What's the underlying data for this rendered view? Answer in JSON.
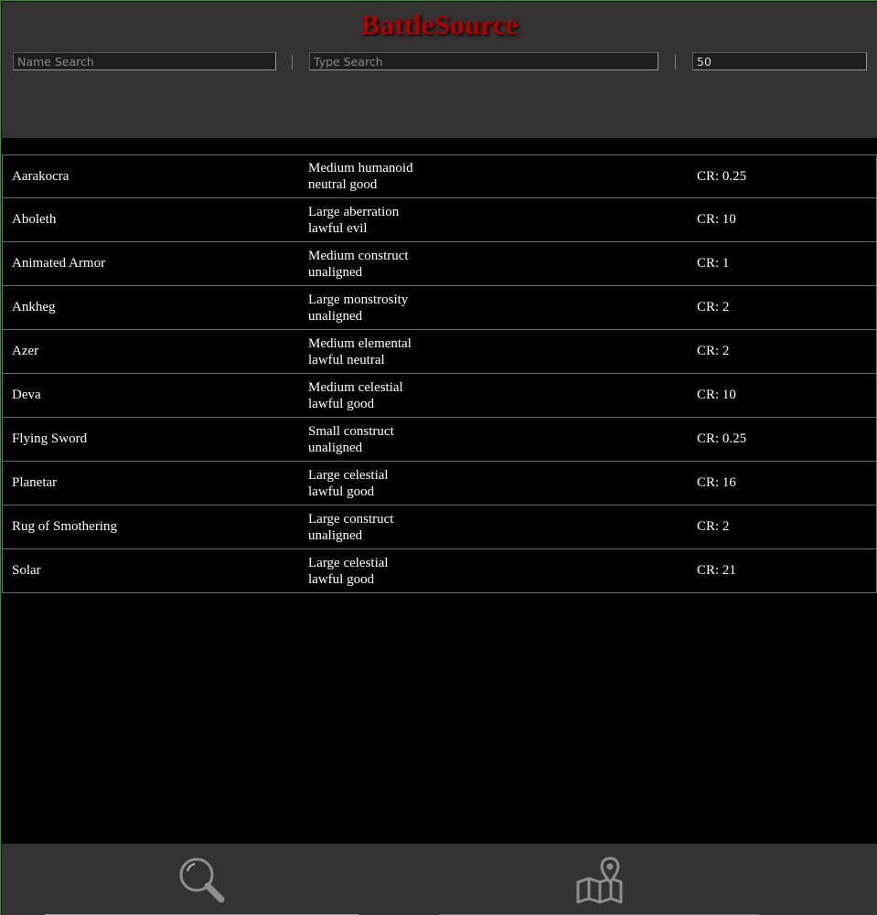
{
  "app": {
    "title": "BattleSource"
  },
  "filters": {
    "name_placeholder": "Name Search",
    "type_placeholder": "Type Search",
    "limit_value": "50"
  },
  "monsters": [
    {
      "name": "Aarakocra",
      "size_type": "Medium humanoid",
      "alignment": "neutral good",
      "cr": "CR: 0.25"
    },
    {
      "name": "Aboleth",
      "size_type": "Large aberration",
      "alignment": "lawful evil",
      "cr": "CR: 10"
    },
    {
      "name": "Animated Armor",
      "size_type": "Medium construct",
      "alignment": "unaligned",
      "cr": "CR: 1"
    },
    {
      "name": "Ankheg",
      "size_type": "Large monstrosity",
      "alignment": "unaligned",
      "cr": "CR: 2"
    },
    {
      "name": "Azer",
      "size_type": "Medium elemental",
      "alignment": "lawful neutral",
      "cr": "CR: 2"
    },
    {
      "name": "Deva",
      "size_type": "Medium celestial",
      "alignment": "lawful good",
      "cr": "CR: 10"
    },
    {
      "name": "Flying Sword",
      "size_type": "Small construct",
      "alignment": "unaligned",
      "cr": "CR: 0.25"
    },
    {
      "name": "Planetar",
      "size_type": "Large celestial",
      "alignment": "lawful good",
      "cr": "CR: 16"
    },
    {
      "name": "Rug of Smothering",
      "size_type": "Large construct",
      "alignment": "unaligned",
      "cr": "CR: 2"
    },
    {
      "name": "Solar",
      "size_type": "Large celestial",
      "alignment": "lawful good",
      "cr": "CR: 21"
    }
  ],
  "nav": {
    "items": [
      {
        "icon": "search-icon",
        "active": true
      },
      {
        "icon": "map-icon",
        "active": false
      }
    ]
  },
  "colors": {
    "title": "#b00000",
    "header_bg": "#333333",
    "list_bg": "#000000",
    "row_border": "#6a6a6a"
  }
}
